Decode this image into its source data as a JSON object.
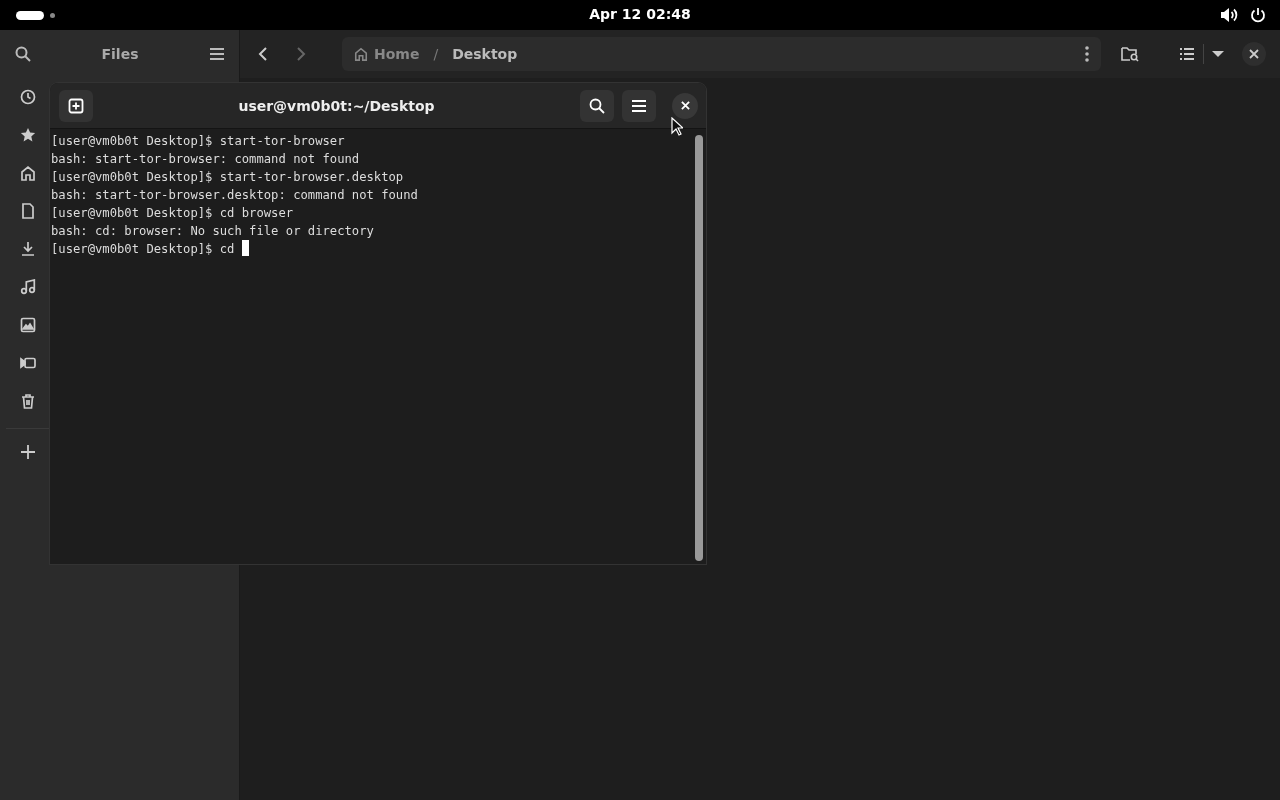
{
  "top_bar": {
    "clock": "Apr 12  02:48"
  },
  "files": {
    "title": "Files",
    "path": [
      {
        "label": "Home",
        "selected": false
      },
      {
        "label": "Desktop",
        "selected": true
      }
    ],
    "path_separator": "/"
  },
  "terminal": {
    "title": "user@vm0b0t:~/Desktop",
    "lines": [
      "[user@vm0b0t Desktop]$ start-tor-browser",
      "bash: start-tor-browser: command not found",
      "[user@vm0b0t Desktop]$ start-tor-browser.desktop",
      "bash: start-tor-browser.desktop: command not found",
      "[user@vm0b0t Desktop]$ cd browser",
      "bash: cd: browser: No such file or directory",
      "[user@vm0b0t Desktop]$ cd "
    ]
  }
}
